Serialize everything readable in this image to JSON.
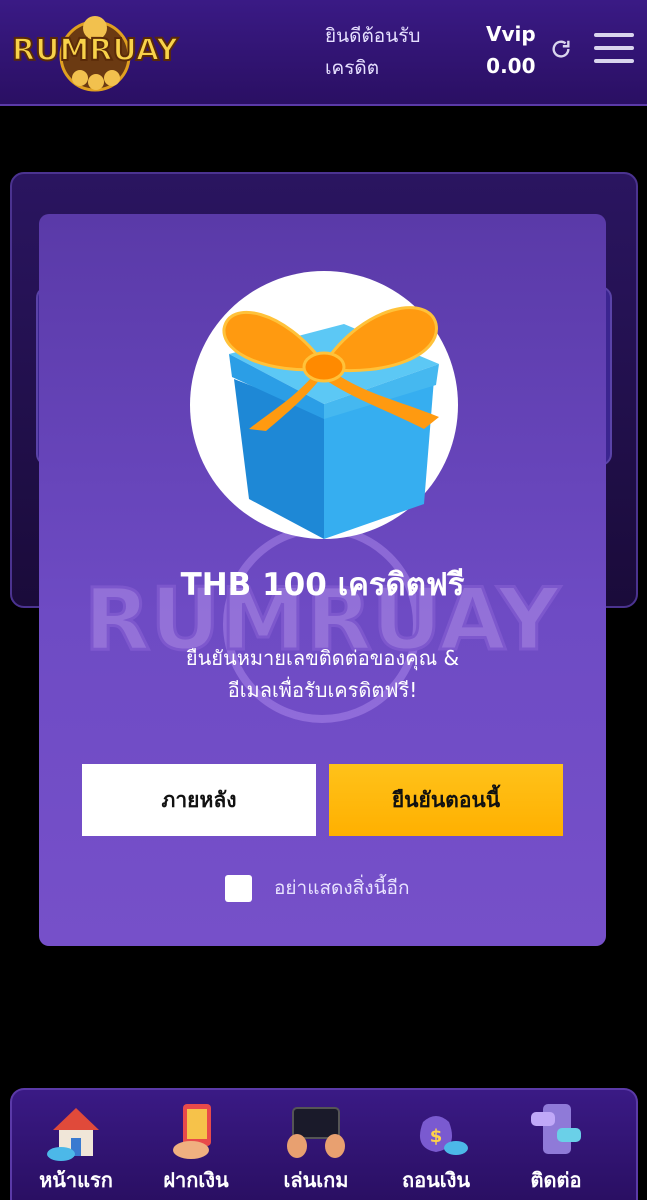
{
  "header": {
    "logo_text": "RUMRUAY",
    "welcome_line1": "ยินดีต้อนรับ",
    "welcome_line2": "เครดิต",
    "vip_label": "Vvip",
    "balance": "0.00"
  },
  "modal": {
    "title": "THB 100 เครดิตฟรี",
    "description_line1": "ยืนยันหมายเลขติดต่อของคุณ &",
    "description_line2": "อีเมลเพื่อรับเครดิตฟรี!",
    "later_button": "ภายหลัง",
    "confirm_button": "ยืนยันตอนนี้",
    "dont_show_label": "อย่าแสดงสิ่งนี้อีก",
    "watermark_text": "RUMRUAY"
  },
  "bottom_nav": {
    "items": [
      {
        "label": "หน้าแรก",
        "icon": "home-icon"
      },
      {
        "label": "ฝากเงิน",
        "icon": "deposit-icon"
      },
      {
        "label": "เล่นเกม",
        "icon": "game-icon"
      },
      {
        "label": "ถอนเงิน",
        "icon": "withdraw-icon"
      },
      {
        "label": "ติดต่อ",
        "icon": "contact-icon"
      }
    ]
  },
  "colors": {
    "header_bg": "#3a1a85",
    "modal_bg": "#6e4bc4",
    "confirm_button": "#ffb000",
    "gift_box": "#2aa0e0",
    "ribbon": "#ff9a10"
  }
}
